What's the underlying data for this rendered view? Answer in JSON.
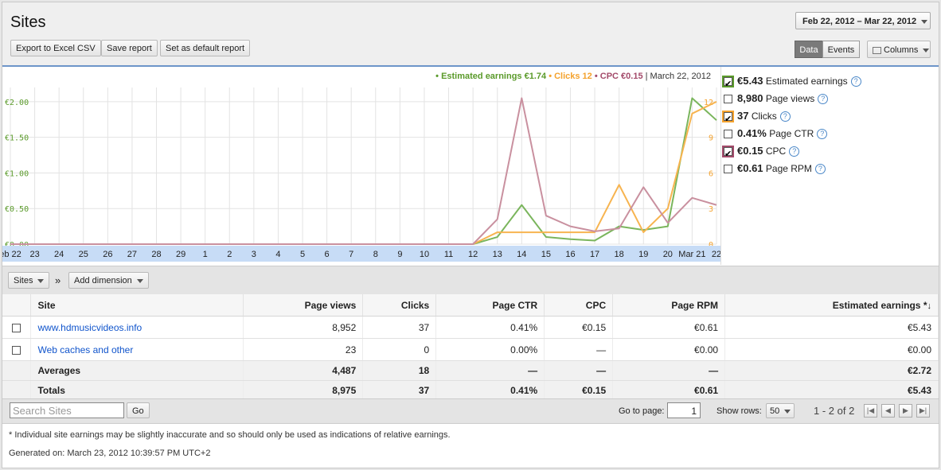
{
  "header": {
    "title": "Sites",
    "date_range": "Feb 22, 2012 – Mar 22, 2012",
    "buttons": [
      "Export to Excel CSV",
      "Save report",
      "Set as default report"
    ],
    "view_toggle": {
      "data": "Data",
      "events": "Events",
      "selected": "Data"
    },
    "columns": "Columns"
  },
  "chart_legend": {
    "earnings": "• Estimated earnings €1.74",
    "clicks": "• Clicks 12",
    "cpc": "• CPC €0.15",
    "date": "| March 22, 2012"
  },
  "metrics": [
    {
      "value": "€5.43",
      "label": "Estimated earnings",
      "checked": true,
      "color": "#5a9a2a"
    },
    {
      "value": "8,980",
      "label": "Page views",
      "checked": false,
      "color": ""
    },
    {
      "value": "37",
      "label": "Clicks",
      "checked": true,
      "color": "#f4a22d"
    },
    {
      "value": "0.41%",
      "label": "Page CTR",
      "checked": false,
      "color": ""
    },
    {
      "value": "€0.15",
      "label": "CPC",
      "checked": true,
      "color": "#a34a6a"
    },
    {
      "value": "€0.61",
      "label": "Page RPM",
      "checked": false,
      "color": ""
    }
  ],
  "chart_data": {
    "type": "line",
    "x": [
      "eb 22",
      "23",
      "24",
      "25",
      "26",
      "27",
      "28",
      "29",
      "1",
      "2",
      "3",
      "4",
      "5",
      "6",
      "7",
      "8",
      "9",
      "10",
      "11",
      "12",
      "13",
      "14",
      "15",
      "16",
      "17",
      "18",
      "19",
      "20",
      "Mar 21",
      "22"
    ],
    "y_left_ticks": [
      "€0.00",
      "€0.50",
      "€1.00",
      "€1.50",
      "€2.00"
    ],
    "y_left_range": [
      0,
      2.2
    ],
    "y_right_ticks": [
      "0",
      "3",
      "6",
      "9",
      "12"
    ],
    "y_right_range": [
      0,
      13.2
    ],
    "grid": true,
    "series": [
      {
        "name": "Estimated earnings",
        "axis": "left",
        "color": "#7ab55c",
        "values": [
          0,
          0,
          0,
          0,
          0,
          0,
          0,
          0,
          0,
          0,
          0,
          0,
          0,
          0,
          0,
          0,
          0,
          0,
          0,
          0,
          0.1,
          0.55,
          0.1,
          0.07,
          0.05,
          0.25,
          0.2,
          0.25,
          2.05,
          1.74
        ]
      },
      {
        "name": "Clicks",
        "axis": "right",
        "color": "#f7b450",
        "values": [
          0,
          0,
          0,
          0,
          0,
          0,
          0,
          0,
          0,
          0,
          0,
          0,
          0,
          0,
          0,
          0,
          0,
          0,
          0,
          0,
          1,
          1,
          1,
          1,
          1,
          5,
          1,
          3,
          11,
          12
        ]
      },
      {
        "name": "CPC",
        "axis": "left",
        "color": "#c9909f",
        "values": [
          0,
          0,
          0,
          0,
          0,
          0,
          0,
          0,
          0,
          0,
          0,
          0,
          0,
          0,
          0,
          0,
          0,
          0,
          0,
          0,
          0.35,
          2.05,
          0.4,
          0.25,
          0.18,
          0.22,
          0.8,
          0.3,
          0.65,
          0.55
        ]
      }
    ]
  },
  "dimension_bar": {
    "sites": "Sites",
    "separator": "»",
    "add_dimension": "Add dimension"
  },
  "table": {
    "headers": {
      "site": "Site",
      "page_views": "Page views",
      "clicks": "Clicks",
      "ctr": "Page CTR",
      "cpc": "CPC",
      "rpm": "Page RPM",
      "earnings": "Estimated earnings *"
    },
    "rows": [
      {
        "site": "www.hdmusicvideos.info",
        "page_views": "8,952",
        "clicks": "37",
        "ctr": "0.41%",
        "cpc": "€0.15",
        "rpm": "€0.61",
        "earnings": "€5.43"
      },
      {
        "site": "Web caches and other",
        "page_views": "23",
        "clicks": "0",
        "ctr": "0.00%",
        "cpc": "—",
        "rpm": "€0.00",
        "earnings": "€0.00"
      }
    ],
    "averages": {
      "label": "Averages",
      "page_views": "4,487",
      "clicks": "18",
      "ctr": "—",
      "cpc": "—",
      "rpm": "—",
      "earnings": "€2.72"
    },
    "totals": {
      "label": "Totals",
      "page_views": "8,975",
      "clicks": "37",
      "ctr": "0.41%",
      "cpc": "€0.15",
      "rpm": "€0.61",
      "earnings": "€5.43"
    }
  },
  "pager": {
    "search_placeholder": "Search Sites",
    "go": "Go",
    "goto_label": "Go to page:",
    "goto_value": "1",
    "rows_label": "Show rows:",
    "rows_value": "50",
    "range": "1 - 2 of 2"
  },
  "footer": {
    "note": "* Individual site earnings may be slightly inaccurate and so should only be used as indications of relative earnings.",
    "generated": "Generated on: March 23, 2012 10:39:57 PM UTC+2"
  }
}
